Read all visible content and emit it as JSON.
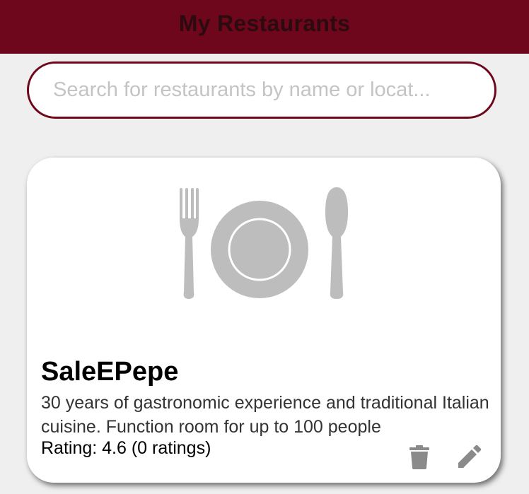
{
  "header": {
    "title": "My Restaurants"
  },
  "search": {
    "placeholder": "Search for restaurants by name or locat..."
  },
  "restaurants": [
    {
      "image_icon": "plate-fork-spoon-icon",
      "name": "SaleEPepe",
      "description": "30 years of gastronomic experience and traditional Italian cuisine. Function room for up to 100 people",
      "rating_text": "Rating: 4.6 (0 ratings)",
      "actions": {
        "delete_icon": "trash-icon",
        "edit_icon": "pencil-icon"
      }
    }
  ],
  "colors": {
    "brand": "#6e071b",
    "header_text": "#2b0a10",
    "background": "#efefef",
    "card": "#ffffff",
    "icon_gray": "#bdbdbd",
    "action_icon": "#8a8a8a",
    "placeholder": "#c4c4c4"
  }
}
